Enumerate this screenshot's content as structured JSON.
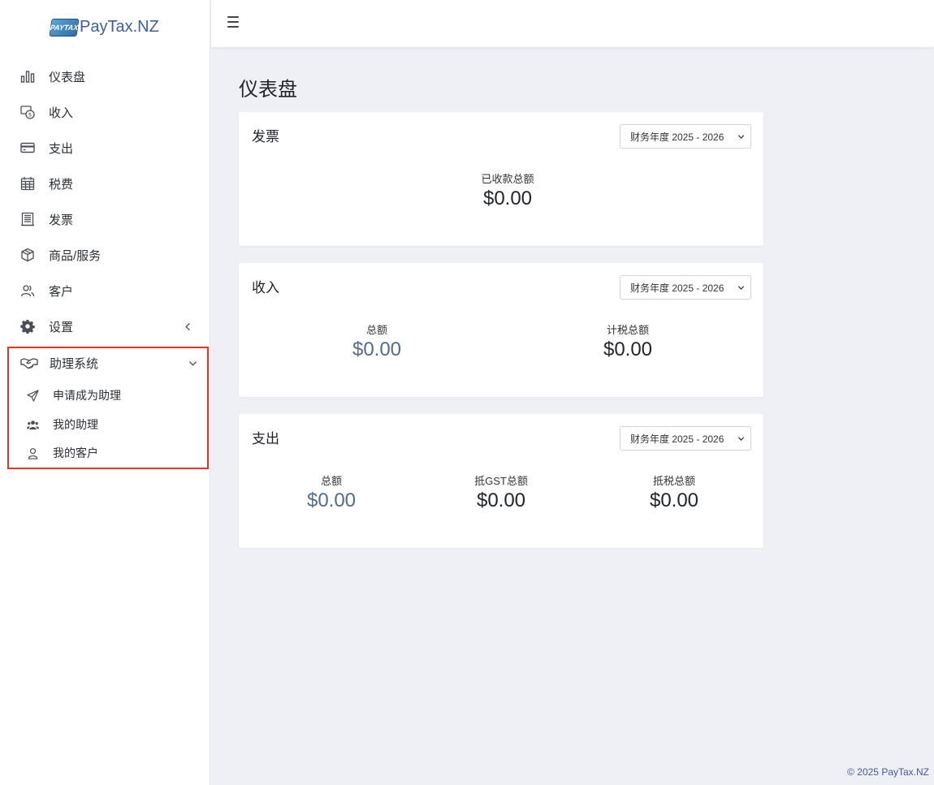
{
  "app": {
    "logo_badge": "PAYTAX",
    "logo_text": "PayTax.NZ"
  },
  "sidebar": {
    "items": [
      {
        "label": "仪表盘",
        "icon": "bar-chart-icon"
      },
      {
        "label": "收入",
        "icon": "income-icon"
      },
      {
        "label": "支出",
        "icon": "credit-card-icon"
      },
      {
        "label": "税费",
        "icon": "calendar-icon"
      },
      {
        "label": "发票",
        "icon": "invoice-icon"
      },
      {
        "label": "商品/服务",
        "icon": "box-icon"
      },
      {
        "label": "客户",
        "icon": "users-icon"
      },
      {
        "label": "设置",
        "icon": "gear-icon"
      }
    ],
    "assistant": {
      "label": "助理系统",
      "icon": "handshake-icon",
      "sub_items": [
        {
          "label": "申请成为助理",
          "icon": "paper-plane-icon"
        },
        {
          "label": "我的助理",
          "icon": "user-group-icon"
        },
        {
          "label": "我的客户",
          "icon": "user-icon"
        }
      ]
    }
  },
  "main": {
    "title": "仪表盘",
    "invoice_card": {
      "title": "发票",
      "year": "财务年度 2025 - 2026",
      "received_label": "已收款总额",
      "received_value": "$0.00"
    },
    "income_card": {
      "title": "收入",
      "year": "财务年度 2025 - 2026",
      "total_label": "总额",
      "total_value": "$0.00",
      "taxable_label": "计税总额",
      "taxable_value": "$0.00"
    },
    "expense_card": {
      "title": "支出",
      "year": "财务年度 2025 - 2026",
      "total_label": "总额",
      "total_value": "$0.00",
      "gst_label": "抵GST总额",
      "gst_value": "$0.00",
      "tax_label": "抵税总额",
      "tax_value": "$0.00"
    }
  },
  "footer": {
    "copyright": "© 2025 PayTax.NZ"
  }
}
